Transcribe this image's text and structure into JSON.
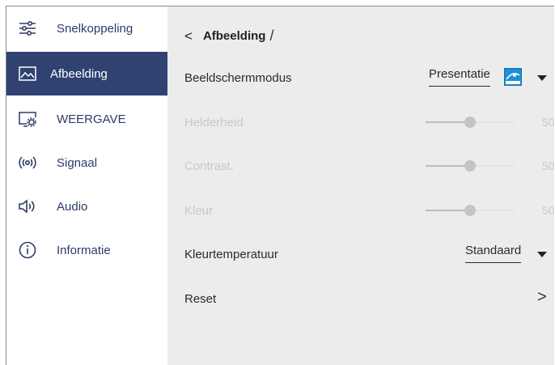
{
  "sidebar": {
    "items": [
      {
        "label": "Snelkoppeling",
        "icon": "sliders-icon"
      },
      {
        "label": "Afbeelding",
        "icon": "picture-icon",
        "active": true
      },
      {
        "label": "WEERGAVE",
        "icon": "display-settings-icon"
      },
      {
        "label": "Signaal",
        "icon": "signal-icon"
      },
      {
        "label": "Audio",
        "icon": "speaker-icon"
      },
      {
        "label": "Informatie",
        "icon": "info-icon"
      }
    ]
  },
  "header": {
    "back_symbol": "<",
    "title": "Afbeelding",
    "separator": "/"
  },
  "settings": {
    "display_mode": {
      "label": "Beeldschermmodus",
      "value": "Presentatie",
      "badge_icon": "energy-star-icon"
    },
    "brightness": {
      "label": "Helderheid",
      "value": "50",
      "level": 0.5,
      "enabled": false
    },
    "contrast": {
      "label": "Contrast.",
      "value": "50",
      "level": 0.5,
      "enabled": false
    },
    "color": {
      "label": "Kleur",
      "value": "50",
      "level": 0.5,
      "enabled": false
    },
    "color_temperature": {
      "label": "Kleurtemperatuur",
      "value": "Standaard"
    },
    "reset": {
      "label": "Reset",
      "arrow": ">"
    }
  },
  "colors": {
    "active_bg": "#2f4272",
    "sidebar_text": "#2d3c66",
    "main_bg": "#ececec",
    "disabled_text": "#c8c8c8"
  }
}
